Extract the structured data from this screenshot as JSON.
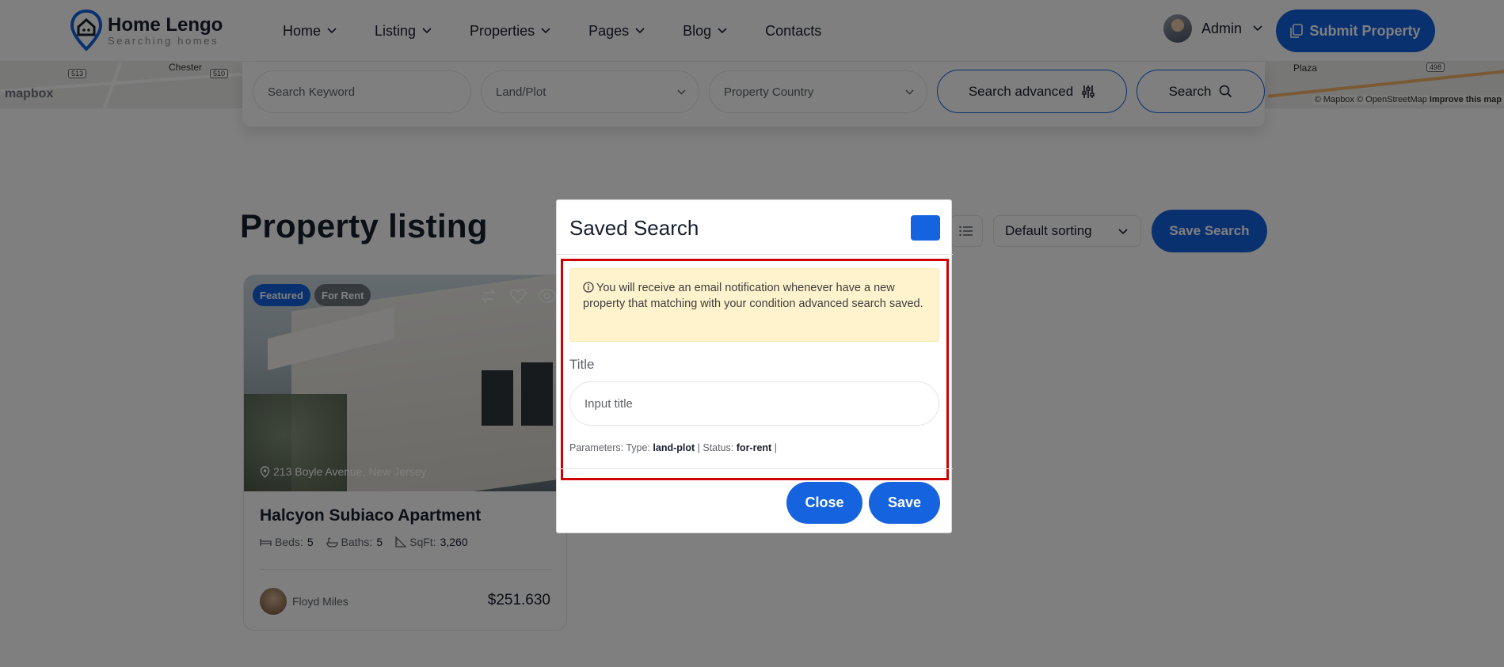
{
  "brand": {
    "name": "Home Lengo",
    "tagline": "Searching homes"
  },
  "nav": {
    "items": [
      {
        "label": "Home",
        "dropdown": true
      },
      {
        "label": "Listing",
        "dropdown": true
      },
      {
        "label": "Properties",
        "dropdown": true
      },
      {
        "label": "Pages",
        "dropdown": true
      },
      {
        "label": "Blog",
        "dropdown": true
      },
      {
        "label": "Contacts",
        "dropdown": false
      }
    ]
  },
  "user": {
    "name": "Admin"
  },
  "submit_property": "Submit Property",
  "map": {
    "labels": [
      "Chester",
      "Plaza"
    ],
    "route_shields": [
      "513",
      "510",
      "498"
    ],
    "logo": "mapbox",
    "attribution": "© Mapbox © OpenStreetMap",
    "improve": "Improve this map"
  },
  "search": {
    "keyword_placeholder": "Search Keyword",
    "type_value": "Land/Plot",
    "country_placeholder": "Property Country",
    "advanced_label": "Search advanced",
    "search_label": "Search"
  },
  "listing": {
    "title": "Property listing",
    "sorting": "Default sorting",
    "save_search": "Save Search"
  },
  "card": {
    "badges": [
      "Featured",
      "For Rent"
    ],
    "address": "213 Boyle Avenue, New Jersey",
    "title": "Halcyon Subiaco Apartment",
    "beds_label": "Beds:",
    "beds": "5",
    "baths_label": "Baths:",
    "baths": "5",
    "sqft_label": "SqFt:",
    "sqft": "3,260",
    "agent": "Floyd Miles",
    "price": "$251.630"
  },
  "modal": {
    "title": "Saved Search",
    "notice": "You will receive an email notification whenever have a new property that matching with your condition advanced search saved.",
    "field_label": "Title",
    "field_placeholder": "Input title",
    "params_prefix": "Parameters: Type:",
    "type_value": "land-plot",
    "status_prefix": "| Status:",
    "status_value": "for-rent",
    "params_suffix": "|",
    "close_label": "Close",
    "save_label": "Save"
  },
  "colors": {
    "primary": "#1563df",
    "notice_bg": "#fff3cd",
    "focus_outline": "#d00000",
    "featured_badge": "#1563df",
    "rent_badge": "#6c757d"
  }
}
